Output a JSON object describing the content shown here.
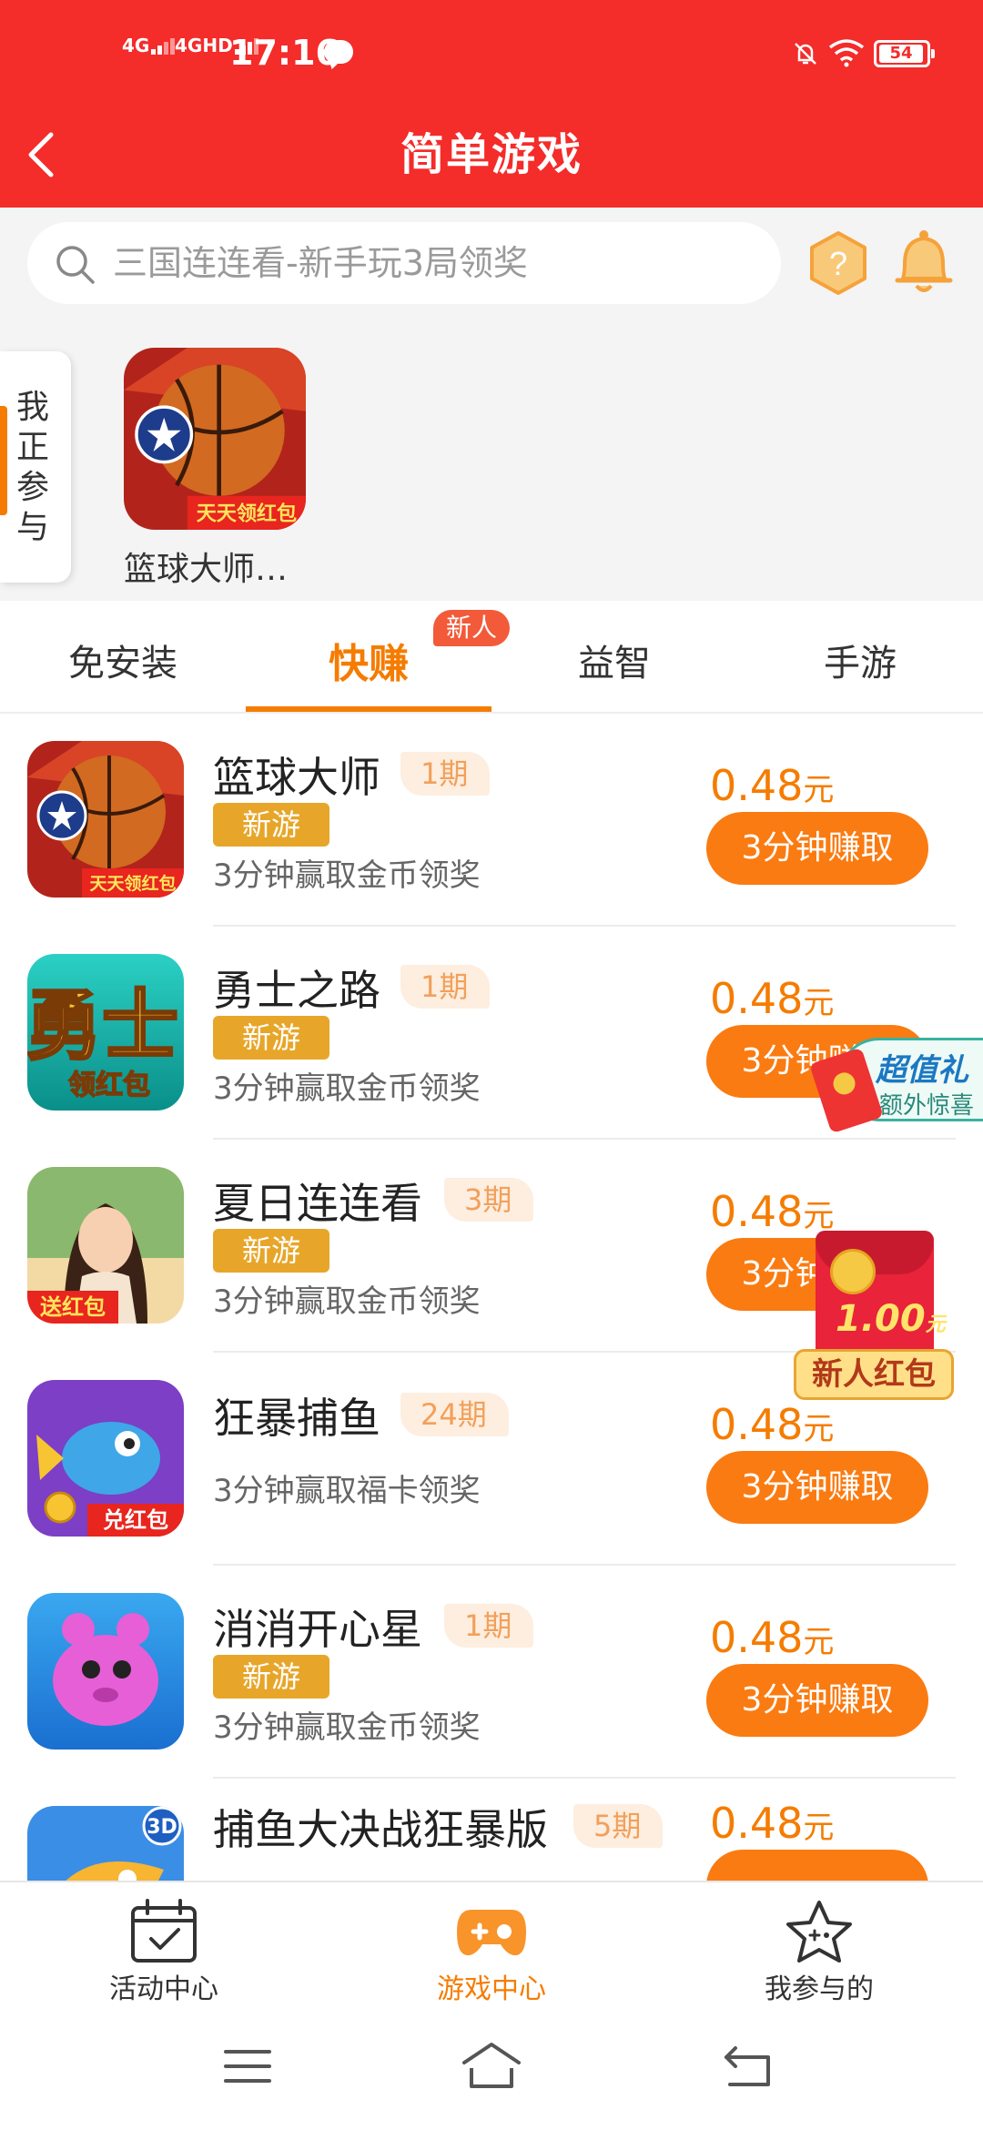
{
  "status_bar": {
    "time": "17:16",
    "network1": "4G",
    "network2": "4GHD",
    "battery": "54"
  },
  "header": {
    "title": "简单游戏"
  },
  "search": {
    "placeholder": "三国连连看-新手玩3局领奖"
  },
  "recent": {
    "side_tab_label": "我正参与",
    "game_name": "篮球大师…",
    "icon_caption": "天天领红包"
  },
  "tabs": [
    {
      "label": "免安装"
    },
    {
      "label": "快赚",
      "badge": "新人"
    },
    {
      "label": "益智"
    },
    {
      "label": "手游"
    }
  ],
  "games": [
    {
      "name": "篮球大师",
      "period": "1期",
      "tag": "新游",
      "desc": "3分钟赢取金币领奖",
      "price": "0.48",
      "unit": "元",
      "button": "3分钟赚取",
      "icon_caption": "天天领红包"
    },
    {
      "name": "勇士之路",
      "period": "1期",
      "tag": "新游",
      "desc": "3分钟赢取金币领奖",
      "price": "0.48",
      "unit": "元",
      "button": "3分钟赚取",
      "icon_caption": "领红包"
    },
    {
      "name": "夏日连连看",
      "period": "3期",
      "tag": "新游",
      "desc": "3分钟赢取金币领奖",
      "price": "0.48",
      "unit": "元",
      "button": "3分钟赚取",
      "icon_caption": "送红包"
    },
    {
      "name": "狂暴捕鱼",
      "period": "24期",
      "desc": "3分钟赢取福卡领奖",
      "price": "0.48",
      "unit": "元",
      "button": "3分钟赚取",
      "icon_caption": "兑红包"
    },
    {
      "name": "消消开心星",
      "period": "1期",
      "tag": "新游",
      "desc": "3分钟赢取金币领奖",
      "price": "0.48",
      "unit": "元",
      "button": "3分钟赚取"
    },
    {
      "name": "捕鱼大决战狂暴版",
      "period": "5期",
      "price": "0.48",
      "unit": "元",
      "icon_caption": "3D"
    }
  ],
  "promos": {
    "gift_title": "超值礼",
    "gift_sub": "额外惊喜",
    "redpacket_amount": "1.00",
    "redpacket_unit": "元",
    "redpacket_label": "新人红包"
  },
  "bottom_nav": [
    {
      "label": "活动中心",
      "icon": "calendar-check-icon"
    },
    {
      "label": "游戏中心",
      "icon": "gamepad-icon"
    },
    {
      "label": "我参与的",
      "icon": "star-icon"
    }
  ],
  "colors": {
    "header_red": "#f42c2a",
    "accent_orange": "#f57c00",
    "button_orange": "#fa7b11",
    "tag_gold": "#e7a62a"
  }
}
